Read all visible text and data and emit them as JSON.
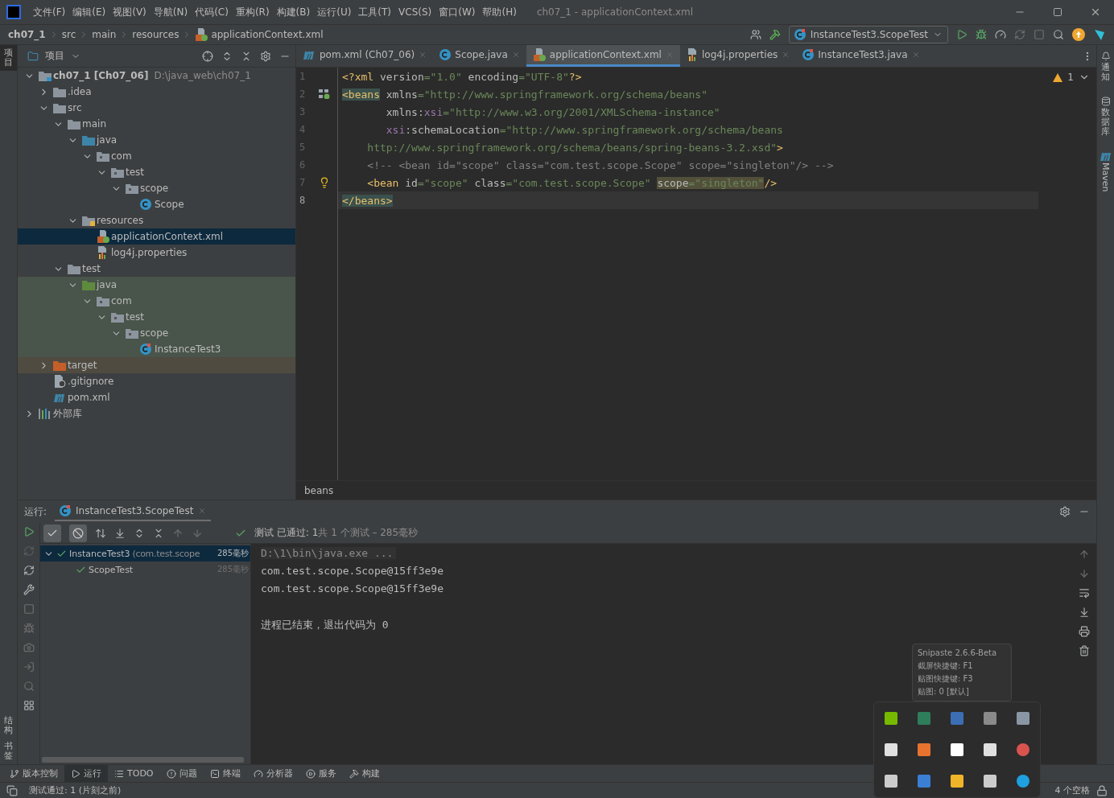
{
  "window": {
    "title": "ch07_1 - applicationContext.xml"
  },
  "menu": [
    "文件(F)",
    "编辑(E)",
    "视图(V)",
    "导航(N)",
    "代码(C)",
    "重构(R)",
    "构建(B)",
    "运行(U)",
    "工具(T)",
    "VCS(S)",
    "窗口(W)",
    "帮助(H)"
  ],
  "breadcrumb": [
    {
      "label": "ch07_1",
      "kind": "project"
    },
    {
      "label": "src",
      "kind": "dir"
    },
    {
      "label": "main",
      "kind": "dir"
    },
    {
      "label": "resources",
      "kind": "dir"
    },
    {
      "label": "applicationContext.xml",
      "kind": "xml"
    }
  ],
  "run_config": "InstanceTest3.ScopeTest",
  "left_stripe": [
    {
      "label": "项目",
      "selected": true
    },
    {
      "label": "结构",
      "selected": false
    },
    {
      "label": "书签",
      "selected": false
    }
  ],
  "right_stripe": [
    {
      "label": "通知",
      "kind": "bell"
    },
    {
      "label": "数据库",
      "kind": "database"
    },
    {
      "label": "Maven",
      "kind": "maven"
    }
  ],
  "project_panel": {
    "title": "项目",
    "tree": [
      {
        "label": "ch07_1",
        "module": "[Ch07_06]",
        "path": "D:\\java_web\\ch07_1",
        "kind": "module",
        "expanded": true,
        "selected": false,
        "children": [
          {
            "label": ".idea",
            "kind": "folder",
            "expanded": false,
            "selected": false
          },
          {
            "label": "src",
            "kind": "folder",
            "expanded": true,
            "selected": false,
            "children": [
              {
                "label": "main",
                "kind": "folder",
                "expanded": true,
                "selected": false,
                "children": [
                  {
                    "label": "java",
                    "kind": "source",
                    "expanded": true,
                    "selected": false,
                    "children": [
                      {
                        "label": "com",
                        "kind": "package",
                        "expanded": true,
                        "selected": false,
                        "children": [
                          {
                            "label": "test",
                            "kind": "package",
                            "expanded": true,
                            "selected": false,
                            "children": [
                              {
                                "label": "scope",
                                "kind": "package",
                                "expanded": true,
                                "selected": false,
                                "children": [
                                  {
                                    "label": "Scope",
                                    "kind": "class",
                                    "selected": false
                                  }
                                ]
                              }
                            ]
                          }
                        ]
                      }
                    ]
                  },
                  {
                    "label": "resources",
                    "kind": "resources",
                    "expanded": true,
                    "selected": false,
                    "children": [
                      {
                        "label": "applicationContext.xml",
                        "kind": "xml",
                        "selected": true
                      },
                      {
                        "label": "log4j.properties",
                        "kind": "properties",
                        "selected": false
                      }
                    ]
                  }
                ]
              },
              {
                "label": "test",
                "kind": "folder",
                "expanded": true,
                "selected": false,
                "children": [
                  {
                    "label": "java",
                    "kind": "test-source",
                    "expanded": true,
                    "selected": false,
                    "children": [
                      {
                        "label": "com",
                        "kind": "test-package",
                        "expanded": true,
                        "selected": false,
                        "children": [
                          {
                            "label": "test",
                            "kind": "test-package",
                            "expanded": true,
                            "selected": false,
                            "children": [
                              {
                                "label": "scope",
                                "kind": "test-package",
                                "expanded": true,
                                "selected": false,
                                "children": [
                                  {
                                    "label": "InstanceTest3",
                                    "kind": "test-class",
                                    "selected": false
                                  }
                                ]
                              }
                            ]
                          }
                        ]
                      }
                    ]
                  }
                ]
              }
            ]
          },
          {
            "label": "target",
            "kind": "excluded",
            "expanded": false,
            "selected": false
          },
          {
            "label": ".gitignore",
            "kind": "ignore",
            "selected": false
          },
          {
            "label": "pom.xml",
            "kind": "maven",
            "selected": false
          }
        ]
      },
      {
        "label": "外部库",
        "kind": "library",
        "expanded": false,
        "selected": false
      }
    ]
  },
  "editor_tabs": [
    {
      "label": "pom.xml (Ch07_06)",
      "kind": "maven",
      "selected": false
    },
    {
      "label": "Scope.java",
      "kind": "class",
      "selected": false
    },
    {
      "label": "applicationContext.xml",
      "kind": "xml",
      "selected": true
    },
    {
      "label": "log4j.properties",
      "kind": "properties",
      "selected": false
    },
    {
      "label": "InstanceTest3.java",
      "kind": "test-class",
      "selected": false
    }
  ],
  "editor": {
    "warnings": "1",
    "lines": [
      {
        "number": "1",
        "current": false,
        "intention": false,
        "bean_marker": false,
        "segments": [
          {
            "kind": "tag",
            "text": "<?xml"
          },
          {
            "kind": "attr",
            "text": " version"
          },
          {
            "kind": "value",
            "text": "=\"1.0\""
          },
          {
            "kind": "attr",
            "text": " encoding"
          },
          {
            "kind": "value",
            "text": "=\"UTF-8\""
          },
          {
            "kind": "tag",
            "text": "?>"
          }
        ]
      },
      {
        "number": "2",
        "current": false,
        "intention": false,
        "bean_marker": true,
        "segments": [
          {
            "kind": "tag-match",
            "text": "<beans"
          },
          {
            "kind": "attr",
            "text": " xmlns"
          },
          {
            "kind": "value",
            "text": "=\"http://www.springframework.org/schema/beans\""
          }
        ]
      },
      {
        "number": "3",
        "current": false,
        "intention": false,
        "bean_marker": false,
        "segments": [
          {
            "kind": "attr",
            "text": "       xmlns:"
          },
          {
            "kind": "ns",
            "text": "xsi"
          },
          {
            "kind": "value",
            "text": "=\"http://www.w3.org/2001/XMLSchema-instance\""
          }
        ]
      },
      {
        "number": "4",
        "current": false,
        "intention": false,
        "bean_marker": false,
        "segments": [
          {
            "kind": "ns",
            "text": "       xsi"
          },
          {
            "kind": "attr",
            "text": ":schemaLocation"
          },
          {
            "kind": "value",
            "text": "=\"http://www.springframework.org/schema/beans"
          }
        ]
      },
      {
        "number": "5",
        "current": false,
        "intention": false,
        "bean_marker": false,
        "segments": [
          {
            "kind": "value",
            "text": "    http://www.springframework.org/schema/beans/spring-beans-3.2.xsd\""
          },
          {
            "kind": "tag",
            "text": ">"
          }
        ]
      },
      {
        "number": "6",
        "current": false,
        "intention": false,
        "bean_marker": false,
        "segments": [
          {
            "kind": "comment",
            "text": "    <!-- <bean id=\"scope\" class=\"com.test.scope.Scope\" scope=\"singleton\"/> -->"
          }
        ]
      },
      {
        "number": "7",
        "current": false,
        "intention": true,
        "bean_marker": false,
        "segments": [
          {
            "kind": "tag",
            "text": "    <bean"
          },
          {
            "kind": "attr",
            "text": " id"
          },
          {
            "kind": "value",
            "text": "=\"scope\""
          },
          {
            "kind": "attr",
            "text": " class"
          },
          {
            "kind": "value",
            "text": "=\"com.test.scope.Scope\" "
          },
          {
            "kind": "attr-hl",
            "text": "scope"
          },
          {
            "kind": "value-hl",
            "text": "=\"singleton\""
          },
          {
            "kind": "tag",
            "text": "/>"
          }
        ]
      },
      {
        "number": "8",
        "current": true,
        "intention": false,
        "bean_marker": false,
        "segments": [
          {
            "kind": "tag-match",
            "text": "</beans>"
          }
        ]
      }
    ],
    "footer": "beans"
  },
  "run_panel": {
    "label": "运行:",
    "tab": "InstanceTest3.ScopeTest",
    "status_main": "测试 已通过: 1",
    "status_rest": "共 1 个测试 – 285毫秒",
    "tests": [
      {
        "name": "InstanceTest3",
        "package": "(com.test.scope",
        "time": "285毫秒",
        "passed": true,
        "selected": true,
        "children": [
          {
            "name": "ScopeTest",
            "time": "285毫秒",
            "passed": true,
            "selected": false
          }
        ]
      }
    ],
    "console": [
      {
        "text": "D:\\1\\bin\\java.exe ...",
        "kind": "command"
      },
      {
        "text": "com.test.scope.Scope@15ff3e9e",
        "kind": "output"
      },
      {
        "text": "com.test.scope.Scope@15ff3e9e",
        "kind": "output"
      },
      {
        "kind": "blank"
      },
      {
        "text": "进程已结束，退出代码为 0",
        "kind": "output"
      }
    ]
  },
  "tool_tabs": [
    {
      "label": "版本控制",
      "kind": "branch",
      "selected": false
    },
    {
      "label": "运行",
      "kind": "play",
      "selected": true
    },
    {
      "label": "TODO",
      "kind": "list",
      "selected": false
    },
    {
      "label": "问题",
      "kind": "alert",
      "selected": false
    },
    {
      "label": "终端",
      "kind": "terminal",
      "selected": false
    },
    {
      "label": "分析器",
      "kind": "gauge",
      "selected": false
    },
    {
      "label": "服务",
      "kind": "service",
      "selected": false
    },
    {
      "label": "构建",
      "kind": "hammer",
      "selected": false
    }
  ],
  "status_bar": {
    "message": "测试通过: 1 (片刻之前)",
    "indent": "4 个空格"
  },
  "tray": {
    "tooltip": [
      "Snipaste 2.6.6-Beta",
      "截屏快捷键: F1",
      "贴图快捷键: F3",
      "贴图: 0 [默认]"
    ]
  }
}
